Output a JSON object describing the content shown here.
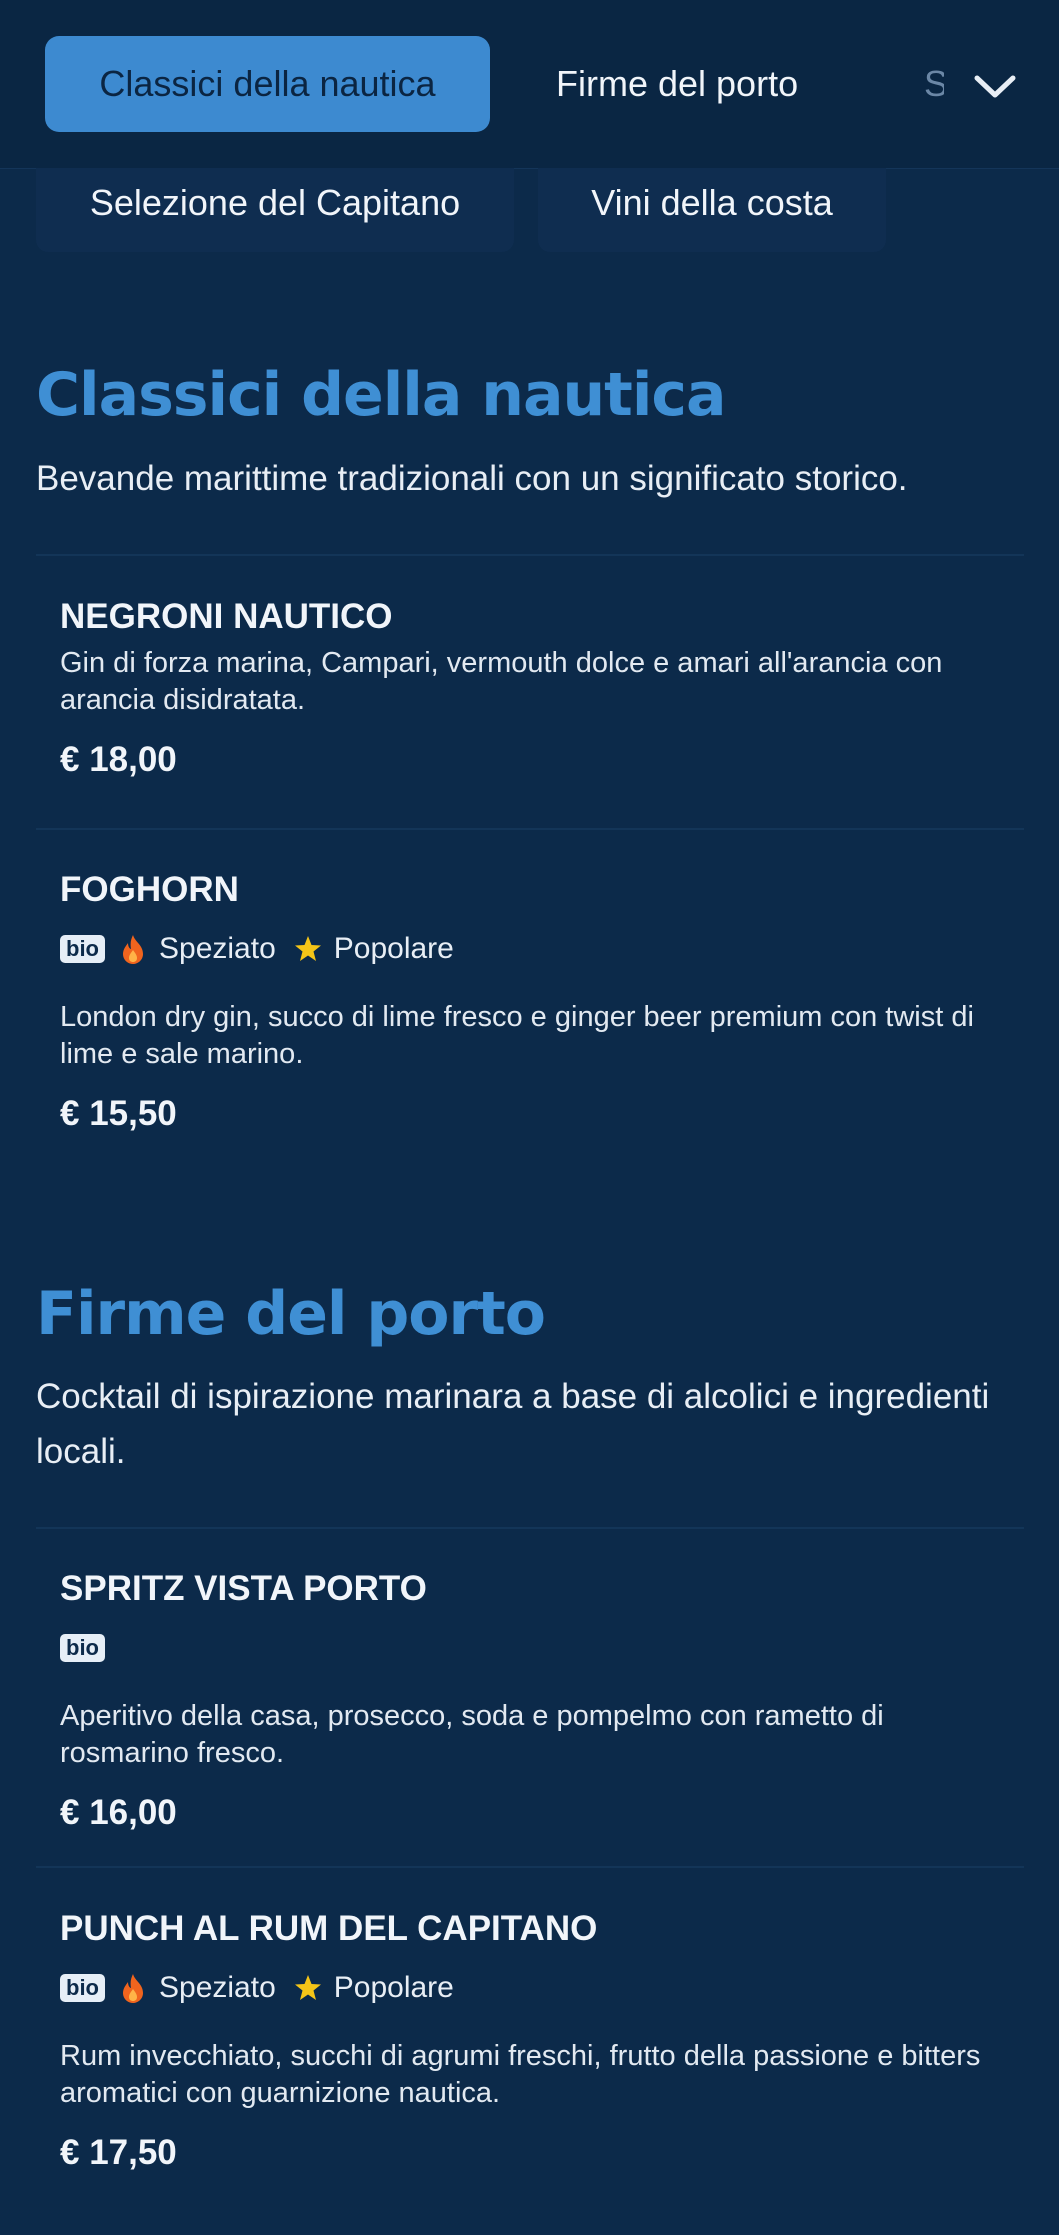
{
  "nav": {
    "tabs": [
      {
        "label": "Classici della nautica"
      },
      {
        "label": "Firme del porto"
      },
      {
        "label": "S"
      }
    ],
    "subtabs": [
      {
        "label": "Selezione del Capitano"
      },
      {
        "label": "Vini della costa"
      }
    ],
    "expand_icon": "chevron-down-icon"
  },
  "sections": [
    {
      "title": "Classici della nautica",
      "description": "Bevande marittime tradizionali con un significato storico.",
      "items": [
        {
          "name": "NEGRONI NAUTICO",
          "description": "Gin di forza marina, Campari, vermouth dolce e amari all'arancia con arancia disidratata.",
          "price": "€ 18,00"
        },
        {
          "name": "FOGHORN",
          "badge": "bio",
          "tags": [
            {
              "icon": "fire-icon",
              "label": "Speziato"
            },
            {
              "icon": "star-icon",
              "label": "Popolare"
            }
          ],
          "description": "London dry gin, succo di lime fresco e ginger beer premium con twist di lime e sale marino.",
          "price": "€ 15,50"
        }
      ]
    },
    {
      "title": "Firme del porto",
      "description": "Cocktail di ispirazione marinara a base di alcolici e ingredienti locali.",
      "items": [
        {
          "name": "SPRITZ VISTA PORTO",
          "badge": "bio",
          "description": "Aperitivo della casa, prosecco, soda e pompelmo con rametto di rosmarino fresco.",
          "price": "€ 16,00"
        },
        {
          "name": "PUNCH AL RUM DEL CAPITANO",
          "badge": "bio",
          "tags": [
            {
              "icon": "fire-icon",
              "label": "Speziato"
            },
            {
              "icon": "star-icon",
              "label": "Popolare"
            }
          ],
          "description": "Rum invecchiato, succhi di agrumi freschi, frutto della passione e bitters aromatici con guarnizione nautica.",
          "price": "€ 17,50"
        }
      ]
    }
  ],
  "colors": {
    "background": "#0c2a4a",
    "accent": "#3d8ad0",
    "fire": "#f0641e",
    "star": "#f5c518"
  }
}
